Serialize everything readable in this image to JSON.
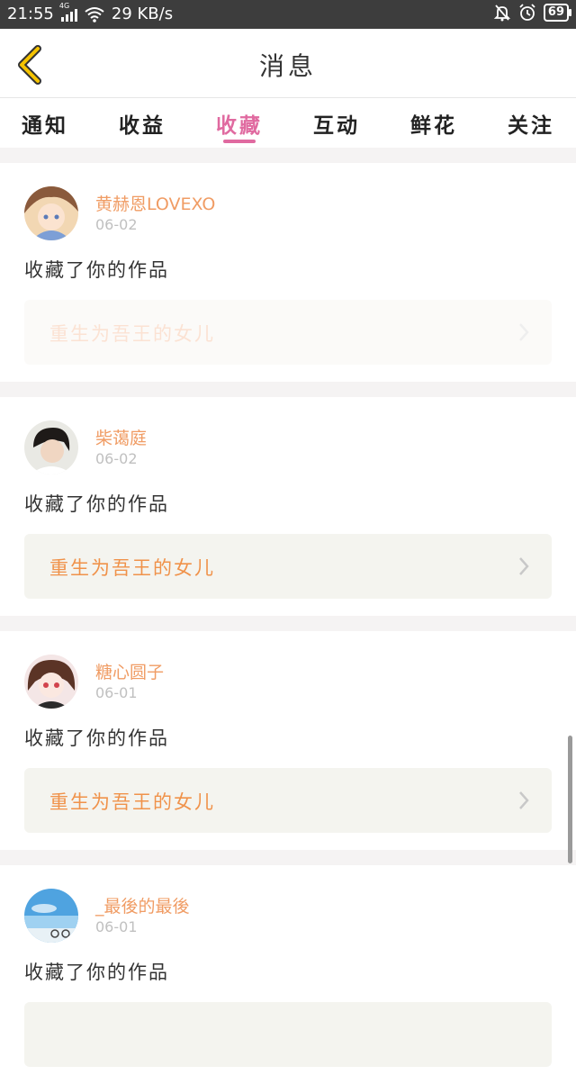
{
  "status_bar": {
    "time": "21:55",
    "network_type": "4G",
    "speed": "29 KB/s",
    "battery": "69",
    "icons": [
      "signal-icon",
      "wifi-icon",
      "bell-off-icon",
      "alarm-icon",
      "battery-icon"
    ]
  },
  "header": {
    "title": "消息",
    "back_icon": "chevron-left-icon",
    "accent_color": "#f5c300"
  },
  "tabs": [
    {
      "label": "通知"
    },
    {
      "label": "收益"
    },
    {
      "label": "收藏",
      "active": true
    },
    {
      "label": "互动"
    },
    {
      "label": "鲜花"
    },
    {
      "label": "关注"
    }
  ],
  "items": [
    {
      "user": "黄赫恩LOVEXO",
      "date": "06-02",
      "message": "收藏了你的作品",
      "work_title": "重生为吾王的女儿",
      "faded": true
    },
    {
      "user": "柴蔼庭",
      "date": "06-02",
      "message": "收藏了你的作品",
      "work_title": "重生为吾王的女儿"
    },
    {
      "user": "糖心圆子",
      "date": "06-01",
      "message": "收藏了你的作品",
      "work_title": "重生为吾王的女儿"
    },
    {
      "user": "_最後的最後",
      "date": "06-01",
      "message": "收藏了你的作品",
      "work_title": ""
    }
  ],
  "colors": {
    "active_tab": "#e06aa0",
    "username": "#f09c64",
    "work_title": "#f0924a",
    "card_bg": "#f4f4ef"
  }
}
